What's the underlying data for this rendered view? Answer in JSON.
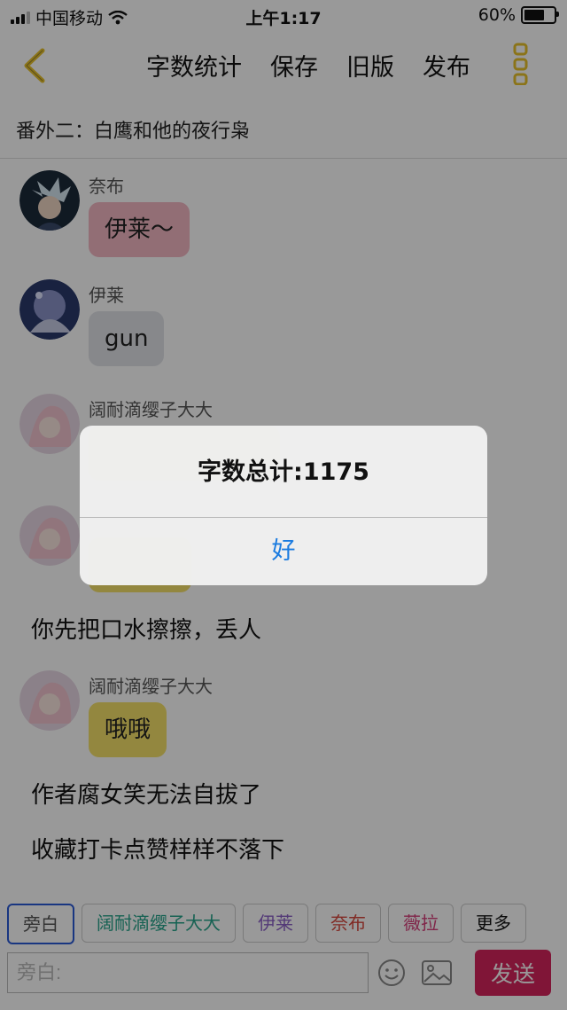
{
  "status_bar": {
    "carrier": "中国移动",
    "time": "上午1:17",
    "battery": "60%",
    "battery_level": 0.6
  },
  "nav": {
    "actions": [
      "字数统计",
      "保存",
      "旧版",
      "发布"
    ]
  },
  "chapter_title": "番外二：白鹰和他的夜行枭",
  "messages": [
    {
      "sender": "奈布",
      "text": "伊莱～",
      "bubble_color": "#f3b8c4"
    },
    {
      "sender": "伊莱",
      "text": "gun",
      "bubble_color": "#e1e3e8"
    },
    {
      "sender": "阔耐滴缨子大大",
      "text": "",
      "bubble_color": "#f5e16a"
    },
    {
      "sender": "",
      "text": "",
      "bubble_color": "#f5e16a"
    },
    {
      "sender": "阔耐滴缨子大大",
      "text": "哦哦",
      "bubble_color": "#f5e16a"
    }
  ],
  "narrations": [
    "你先把口水擦擦，丢人",
    "作者腐女笑无法自拔了",
    "收藏打卡点赞样样不落下"
  ],
  "roles": [
    {
      "label": "旁白",
      "color": "#555555"
    },
    {
      "label": "阔耐滴缨子大大",
      "color": "#26a38a"
    },
    {
      "label": "伊莱",
      "color": "#8b5fc7"
    },
    {
      "label": "奈布",
      "color": "#d7473d"
    },
    {
      "label": "薇拉",
      "color": "#d63f7a"
    },
    {
      "label": "更多",
      "color": "#111111"
    }
  ],
  "input": {
    "placeholder": "旁白:"
  },
  "send_label": "发送",
  "alert": {
    "title": "字数总计:1175",
    "ok": "好"
  },
  "colors": {
    "accent": "#e8c22a",
    "send": "#d6245c",
    "alert_button": "#1a7be0"
  }
}
